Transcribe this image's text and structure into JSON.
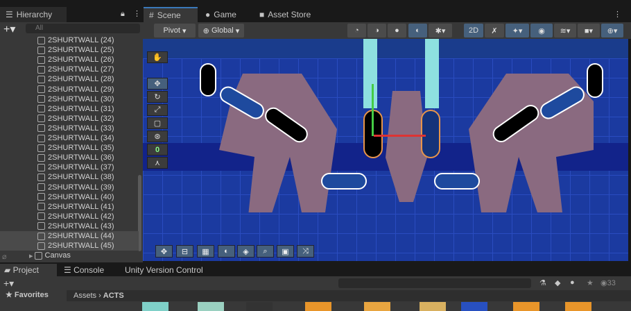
{
  "tabs_top": {
    "hierarchy": "Hierarchy",
    "scene": "Scene",
    "game": "Game",
    "asset_store": "Asset Store"
  },
  "hierarchy": {
    "search_placeholder": "All",
    "items": [
      "2SHURTWALL (24)",
      "2SHURTWALL (25)",
      "2SHURTWALL (26)",
      "2SHURTWALL (27)",
      "2SHURTWALL (28)",
      "2SHURTWALL (29)",
      "2SHURTWALL (30)",
      "2SHURTWALL (31)",
      "2SHURTWALL (32)",
      "2SHURTWALL (33)",
      "2SHURTWALL (34)",
      "2SHURTWALL (35)",
      "2SHURTWALL (36)",
      "2SHURTWALL (37)",
      "2SHURTWALL (38)",
      "2SHURTWALL (39)",
      "2SHURTWALL (40)",
      "2SHURTWALL (41)",
      "2SHURTWALL (42)",
      "2SHURTWALL (43)",
      "2SHURTWALL (44)",
      "2SHURTWALL (45)"
    ],
    "canvas": "Canvas"
  },
  "scene_toolbar": {
    "pivot": "Pivot",
    "global": "Global",
    "mode_2d": "2D"
  },
  "scene_tools": {
    "snap_value": "0"
  },
  "bottom_tabs": {
    "project": "Project",
    "console": "Console",
    "uvc": "Unity Version Control"
  },
  "project": {
    "favorites": "Favorites",
    "breadcrumb_root": "Assets",
    "breadcrumb_current": "ACTS",
    "hidden_count": "33"
  },
  "colors": {
    "accent": "#3a79bb",
    "scene_bg": "#1a3a9a",
    "selected": "#46607c"
  }
}
